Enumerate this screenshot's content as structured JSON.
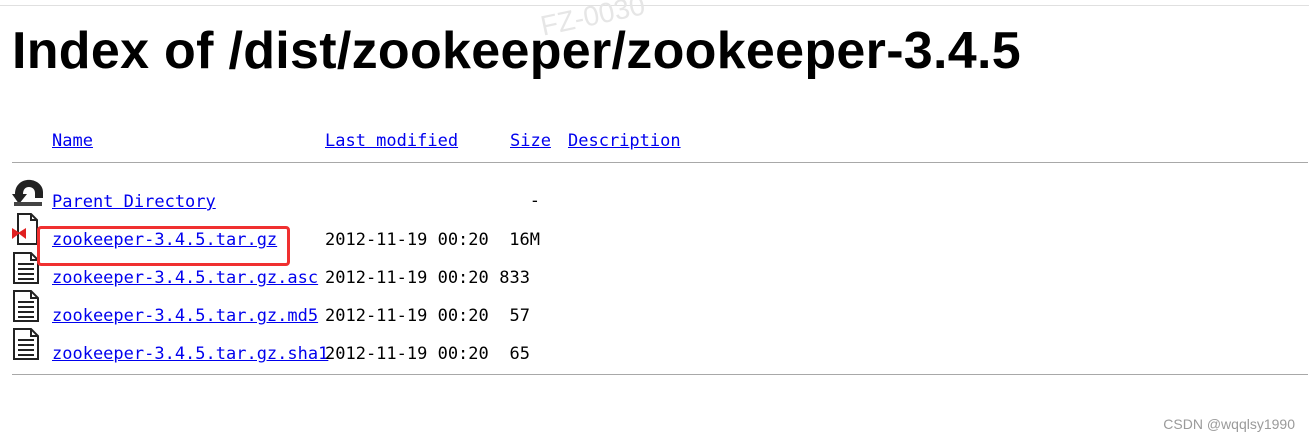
{
  "page": {
    "title": "Index of /dist/zookeeper/zookeeper-3.4.5"
  },
  "columns": {
    "name": "Name",
    "last_modified": "Last modified",
    "size": "Size",
    "description": "Description"
  },
  "entries": [
    {
      "name": "Parent Directory",
      "last_modified": "",
      "size": "-",
      "description": "",
      "icon": "back-arrow-icon"
    },
    {
      "name": "zookeeper-3.4.5.tar.gz",
      "last_modified": "2012-11-19 00:20",
      "size": "16M",
      "description": "",
      "icon": "compressed-file-icon"
    },
    {
      "name": "zookeeper-3.4.5.tar.gz.asc",
      "last_modified": "2012-11-19 00:20",
      "size": "833",
      "description": "",
      "icon": "text-file-icon"
    },
    {
      "name": "zookeeper-3.4.5.tar.gz.md5",
      "last_modified": "2012-11-19 00:20",
      "size": "57",
      "description": "",
      "icon": "text-file-icon"
    },
    {
      "name": "zookeeper-3.4.5.tar.gz.sha1",
      "last_modified": "2012-11-19 00:20",
      "size": "65",
      "description": "",
      "icon": "text-file-icon"
    }
  ],
  "overlay": {
    "watermark_top": "FZ-0030",
    "csdn_watermark": "CSDN @wqqlsy1990",
    "highlight_color": "#f03030"
  }
}
